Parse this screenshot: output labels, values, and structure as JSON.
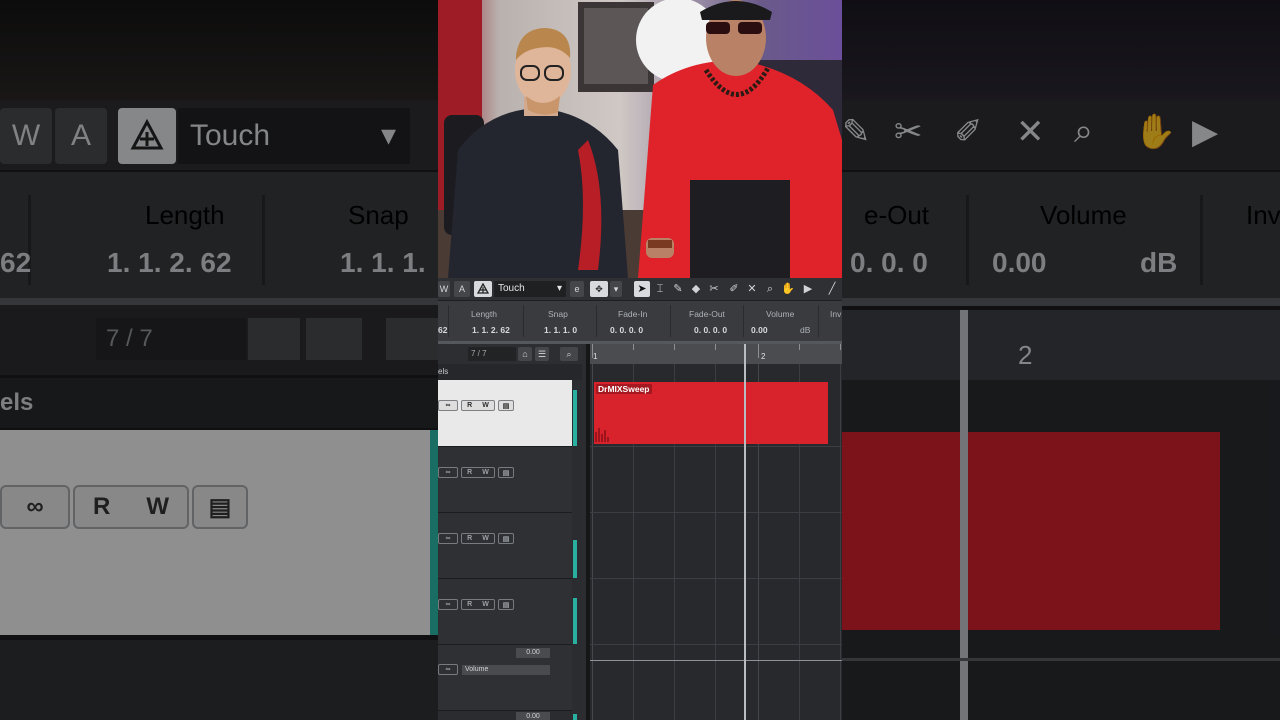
{
  "toolbar": {
    "w_label": "W",
    "a_label": "A",
    "automation_mode": "Touch",
    "snap_toggle_label": "e",
    "dropdown_arrow": "▾",
    "tools": [
      "pointer-icon",
      "range-icon",
      "pencil-icon",
      "eraser-icon",
      "scissors-icon",
      "glue-icon",
      "mute-icon",
      "zoom-icon",
      "hand-icon",
      "play-icon"
    ]
  },
  "infobar": {
    "fields": [
      {
        "label": "",
        "value": "62"
      },
      {
        "label": "Length",
        "value": "1. 1. 2. 62"
      },
      {
        "label": "Snap",
        "value": "1. 1. 1.   0"
      },
      {
        "label": "Fade-In",
        "value": "0. 0. 0.   0"
      },
      {
        "label": "Fade-Out",
        "value": "0. 0. 0.   0"
      },
      {
        "label": "Volume",
        "value": "0.00",
        "unit": "dB"
      },
      {
        "label": "Inv",
        "value": ""
      }
    ]
  },
  "tracklist": {
    "count": "7 / 7",
    "section_label": "els",
    "track_buttons": {
      "read": "R",
      "write": "W"
    },
    "volume_label": "Volume",
    "volume_value_1": "0.00",
    "volume_value_2": "0.00"
  },
  "arrange": {
    "ruler_marks": [
      "1",
      "2"
    ],
    "event_name": "DrMIXSweep"
  },
  "colors": {
    "event": "#d8232c",
    "meter": "#2ab0a0",
    "toolbar": "#2f3033"
  },
  "background_blow_up": {
    "automation_mode": "Touch",
    "length_label": "Length",
    "length_value": "1. 1. 2. 62",
    "snap_label": "Snap",
    "snap_value": "1. 1. 1.",
    "fade_out_label": "e-Out",
    "fade_out_value": "0. 0.   0",
    "volume_label": "Volume",
    "volume_value": "0.00",
    "volume_unit": "dB",
    "inv_label": "Inv",
    "count": "7 / 7",
    "section_label": "els",
    "left_value_partial": "62",
    "ruler_mark": "2",
    "w_label": "W",
    "a_label": "A",
    "read_label": "R",
    "write_label": "W"
  }
}
